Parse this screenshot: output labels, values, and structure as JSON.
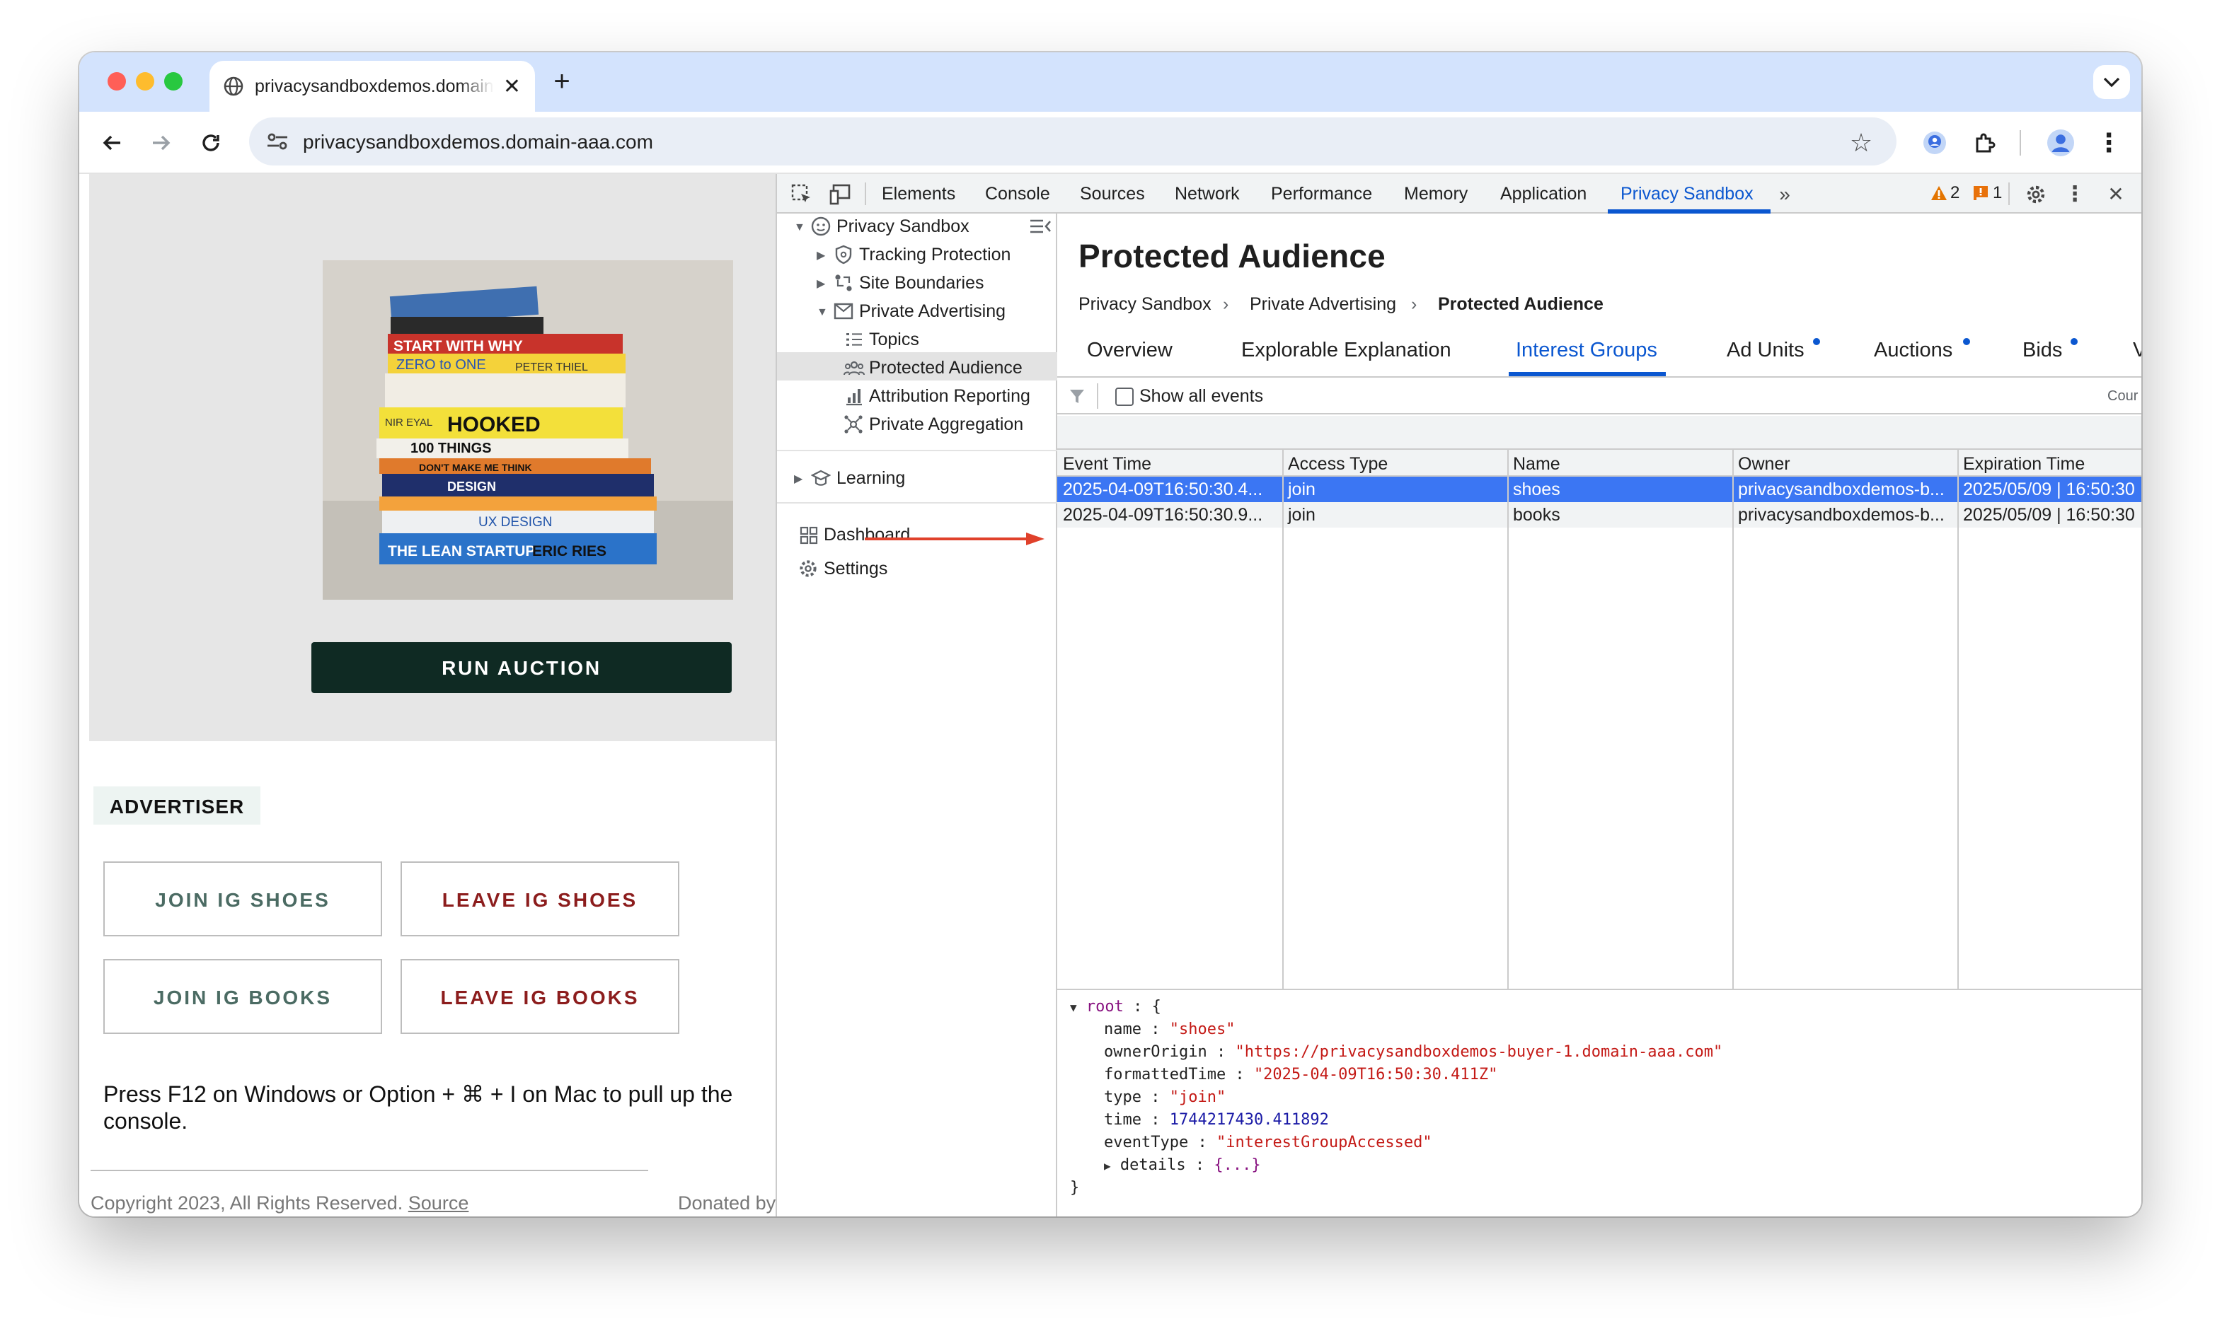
{
  "browser": {
    "tab_title": "privacysandboxdemos.domain-aaa.com",
    "url": "privacysandboxdemos.domain-aaa.com"
  },
  "page": {
    "run_auction": "RUN AUCTION",
    "advertiser_label": "ADVERTISER",
    "buttons": {
      "join_shoes": "JOIN IG SHOES",
      "leave_shoes": "LEAVE IG SHOES",
      "join_books": "JOIN IG BOOKS",
      "leave_books": "LEAVE IG BOOKS"
    },
    "instructions_line1": "Press F12 on Windows or Option + ⌘ + I on Mac to pull up the",
    "instructions_line2": "console.",
    "copyright": "Copyright 2023, All Rights Reserved.",
    "source_link": "Source",
    "donated": "Donated by",
    "book_titles": [
      "START WITH WHY",
      "ZERO to ONE",
      "PETER THIEL",
      "HOOKED",
      "100 THINGS",
      "DON'T MAKE ME THINK",
      "DESIGN",
      "UX DESIGN",
      "THE LEAN STARTUP",
      "ERIC RIES",
      "NIR EYAL"
    ]
  },
  "devtools": {
    "tabs": [
      "Elements",
      "Console",
      "Sources",
      "Network",
      "Performance",
      "Memory",
      "Application",
      "Privacy Sandbox"
    ],
    "active_tab": "Privacy Sandbox",
    "warnings_count": "2",
    "issues_count": "1",
    "sidebar": {
      "root": "Privacy Sandbox",
      "tracking_protection": "Tracking Protection",
      "site_boundaries": "Site Boundaries",
      "private_advertising": "Private Advertising",
      "topics": "Topics",
      "protected_audience": "Protected Audience",
      "attribution_reporting": "Attribution Reporting",
      "private_aggregation": "Private Aggregation",
      "learning": "Learning",
      "dashboard": "Dashboard",
      "settings": "Settings"
    },
    "panel": {
      "title": "Protected Audience",
      "breadcrumb": [
        "Privacy Sandbox",
        "Private Advertising",
        "Protected Audience"
      ],
      "tabs": [
        "Overview",
        "Explorable Explanation",
        "Interest Groups",
        "Ad Units",
        "Auctions",
        "Bids",
        "V"
      ],
      "active_tab": "Interest Groups",
      "show_all_events": "Show all events",
      "count_label": "Cour",
      "columns": [
        "Event Time",
        "Access Type",
        "Name",
        "Owner",
        "Expiration Time"
      ],
      "rows": [
        {
          "event_time": "2025-04-09T16:50:30.4...",
          "access_type": "join",
          "name": "shoes",
          "owner": "privacysandboxdemos-b...",
          "expiration": "2025/05/09 | 16:50:30"
        },
        {
          "event_time": "2025-04-09T16:50:30.9...",
          "access_type": "join",
          "name": "books",
          "owner": "privacysandboxdemos-b...",
          "expiration": "2025/05/09 | 16:50:30"
        }
      ],
      "json": {
        "root_label": "root",
        "open_brace": "{",
        "close_brace": "}",
        "name_key": "name",
        "name_val": "\"shoes\"",
        "owner_key": "ownerOrigin",
        "owner_val": "\"https://privacysandboxdemos-buyer-1.domain-aaa.com\"",
        "ftime_key": "formattedTime",
        "ftime_val": "\"2025-04-09T16:50:30.411Z\"",
        "type_key": "type",
        "type_val": "\"join\"",
        "time_key": "time",
        "time_val": "1744217430.411892",
        "etype_key": "eventType",
        "etype_val": "\"interestGroupAccessed\"",
        "details_key": "details",
        "details_val": "{...}"
      }
    }
  },
  "colors": {
    "accent_blue": "#0b57d0",
    "selected_row": "#3b76f3",
    "arrow_red": "#e0412b",
    "run_button": "#0f2a23"
  }
}
